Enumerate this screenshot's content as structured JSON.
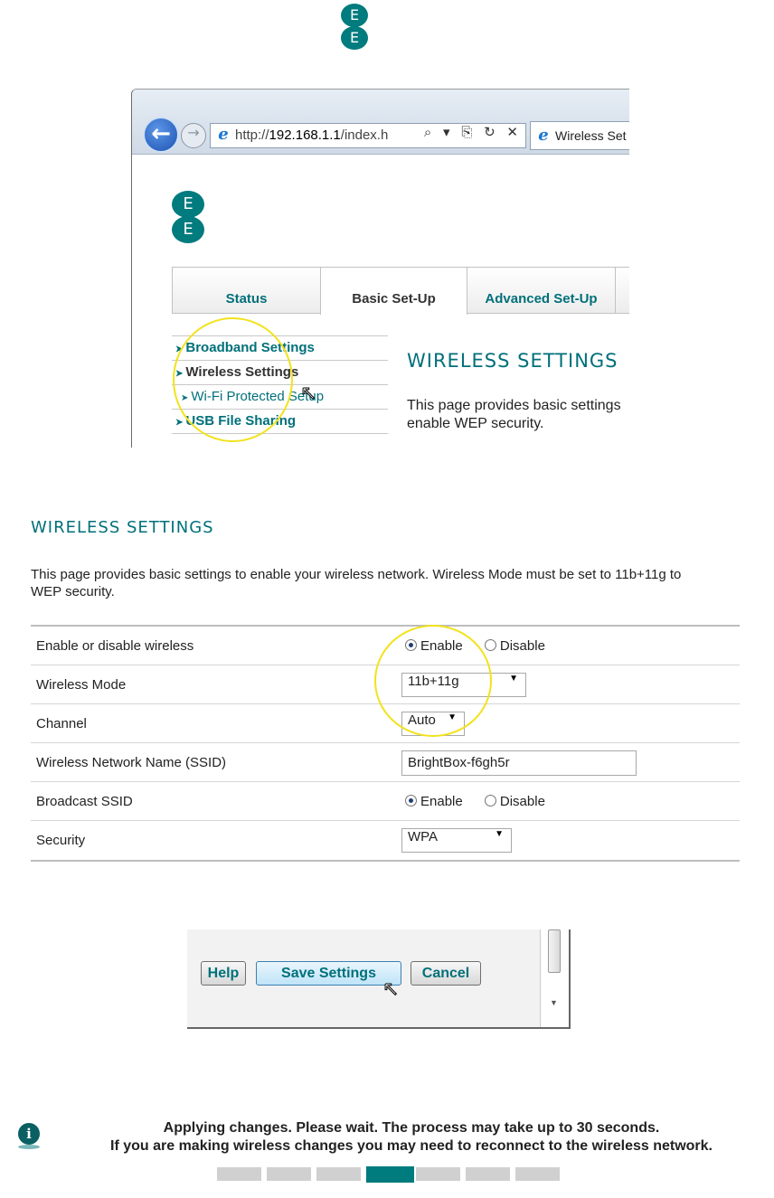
{
  "brand": {
    "logo_letters": [
      "E",
      "E"
    ],
    "accent_color": "#007b7e",
    "highlight_color": "#f2e21d"
  },
  "browser": {
    "address_prefix": "http://",
    "address_host": "192.168.1.1",
    "address_path": "/index.h",
    "address_tools": "⌕ ▾ ⎘ ↻ ✕",
    "tab_title": "Wireless Set",
    "page_logo_letters": [
      "E",
      "E"
    ],
    "nav_tabs": [
      "Status",
      "Basic Set-Up",
      "Advanced Set-Up"
    ],
    "side_menu": [
      {
        "label": "Broadband Settings"
      },
      {
        "label": "Wireless Settings"
      },
      {
        "label": "Wi-Fi Protected Setup"
      },
      {
        "label": "USB File Sharing"
      }
    ],
    "content_title": "WIRELESS SETTINGS",
    "content_desc_line1": "This page provides basic settings",
    "content_desc_line2": "enable WEP security."
  },
  "wireless": {
    "title": "WIRELESS SETTINGS",
    "desc_line1": "This page provides basic settings to enable your wireless network. Wireless Mode must be set to 11b+11g to",
    "desc_line2": "WEP security.",
    "rows": {
      "enable_label": "Enable or disable wireless",
      "mode_label": "Wireless Mode",
      "mode_value": "11b+11g",
      "channel_label": "Channel",
      "channel_value": "Auto",
      "ssid_label": "Wireless Network Name (SSID)",
      "ssid_value": "BrightBox-f6gh5r",
      "broadcast_label": "Broadcast SSID",
      "security_label": "Security",
      "security_value": "WPA"
    },
    "opt_enable": "Enable",
    "opt_disable": "Disable"
  },
  "buttons": {
    "help": "Help",
    "save": "Save Settings",
    "cancel": "Cancel"
  },
  "status": {
    "line1": "Applying changes. Please wait. The process may take up to 30 seconds.",
    "line2": "If you are making wireless changes you may need to reconnect to the wireless network.",
    "progress_segments": 7,
    "progress_active_segment": 4
  }
}
